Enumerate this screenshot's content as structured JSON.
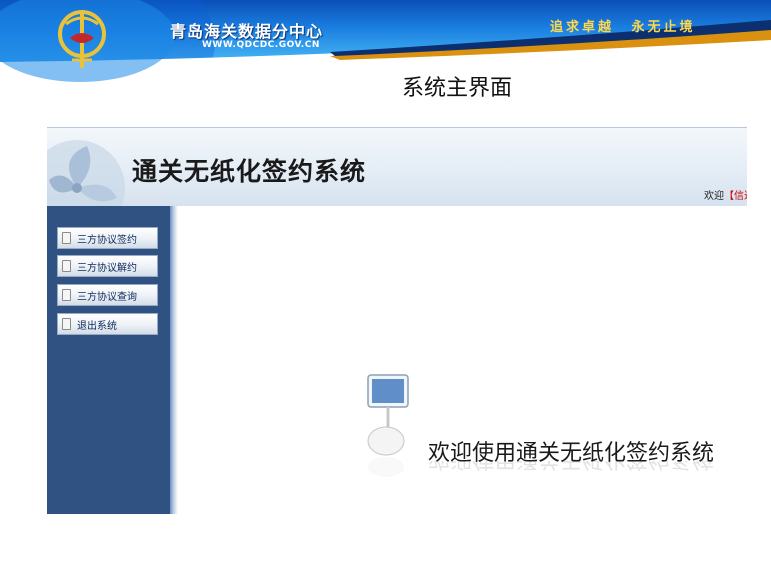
{
  "banner": {
    "title": "青岛海关数据分中心",
    "url": "WWW.QDCDC.GOV.CN",
    "motto": "追求卓越   永无止境"
  },
  "page_heading": "系统主界面",
  "app": {
    "title": "通关无纸化签约系统",
    "welcome_prefix": "欢迎",
    "welcome_bracket": "【",
    "welcome_user": "信达"
  },
  "sidebar": {
    "items": [
      {
        "label": "三方协议签约",
        "icon": "document-icon"
      },
      {
        "label": "三方协议解约",
        "icon": "document-icon"
      },
      {
        "label": "三方协议查询",
        "icon": "document-icon"
      },
      {
        "label": "退出系统",
        "icon": "document-icon"
      }
    ]
  },
  "content": {
    "welcome_text": "欢迎使用通关无纸化签约系统"
  },
  "colors": {
    "sidebar": "#2f5282",
    "banner_blue": "#1b7fe0",
    "motto_yellow": "#ffd84a",
    "welcome_user": "#cc0000"
  }
}
